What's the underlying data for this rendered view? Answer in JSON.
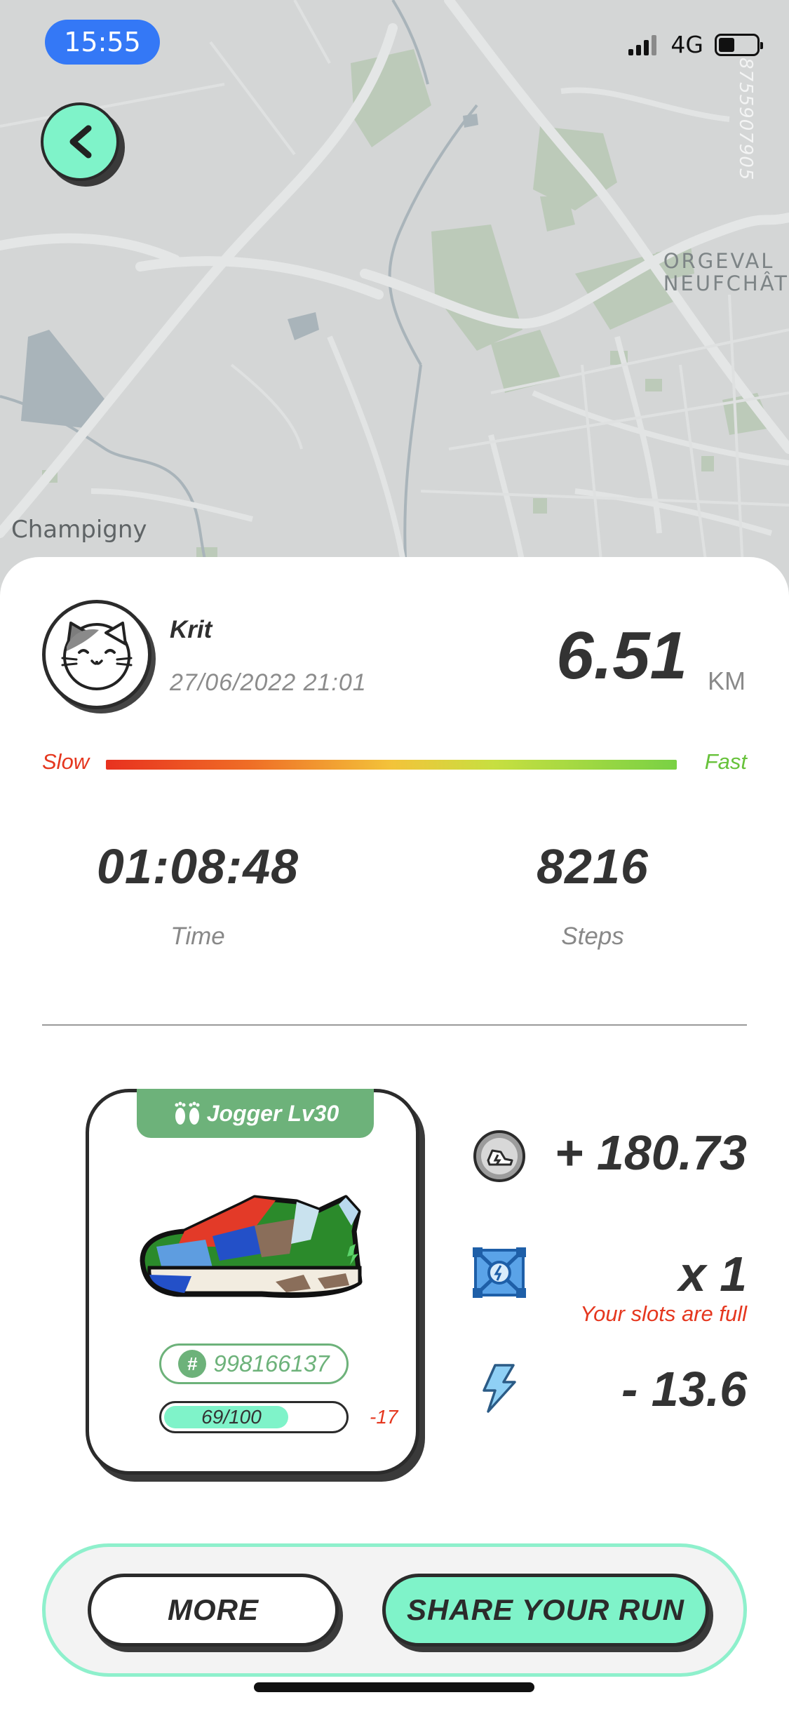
{
  "status_bar": {
    "time": "15:55",
    "network": "4G"
  },
  "map": {
    "labels": {
      "orgeval_line1": "ORGEVAL",
      "orgeval_line2": "NEUFCHÂT",
      "champigny": "Champigny"
    },
    "watermark": "8755907905"
  },
  "run": {
    "username": "Krit",
    "datetime": "27/06/2022 21:01",
    "distance": "6.51",
    "distance_unit": "KM",
    "speed_slow_label": "Slow",
    "speed_fast_label": "Fast",
    "time_value": "01:08:48",
    "time_label": "Time",
    "steps_value": "8216",
    "steps_label": "Steps"
  },
  "sneaker": {
    "tag": "Jogger Lv30",
    "id_symbol": "#",
    "id": "998166137",
    "durability_text": "69/100",
    "durability_fraction": 0.69,
    "durability_delta": "-17"
  },
  "rewards": {
    "gst": "+ 180.73",
    "slots": "x 1",
    "slots_note": "Your slots are full",
    "energy": "- 13.6"
  },
  "buttons": {
    "more": "MORE",
    "share": "SHARE YOUR RUN"
  },
  "colors": {
    "accent_mint": "#7ff3c9",
    "accent_green": "#6db27a",
    "warning_red": "#e5371f",
    "status_blue": "#3478f6"
  }
}
